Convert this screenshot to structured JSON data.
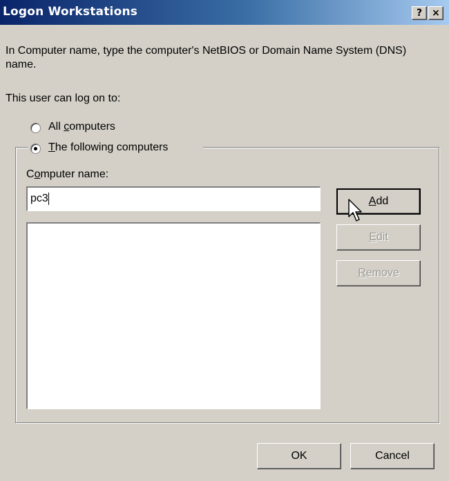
{
  "window": {
    "title": "Logon Workstations",
    "help_label": "?",
    "close_label": "×"
  },
  "description": "In Computer name, type the computer's NetBIOS or Domain Name System (DNS) name.",
  "logon_to_label": "This user can log on to:",
  "options": {
    "all_computers": {
      "pre": "All ",
      "accel": "c",
      "post": "omputers",
      "selected": false
    },
    "following_computers": {
      "pre": "",
      "accel": "T",
      "post": "he following computers",
      "selected": true
    }
  },
  "computer_name": {
    "label_pre": "C",
    "label_accel": "o",
    "label_post": "mputer name:",
    "value": "pc3"
  },
  "computers_list": [],
  "buttons": {
    "add": {
      "accel": "A",
      "post": "dd",
      "enabled": true
    },
    "edit": {
      "accel": "E",
      "post": "dit",
      "enabled": false
    },
    "remove": {
      "accel": "R",
      "post": "emove",
      "enabled": false
    },
    "ok": "OK",
    "cancel": "Cancel"
  }
}
